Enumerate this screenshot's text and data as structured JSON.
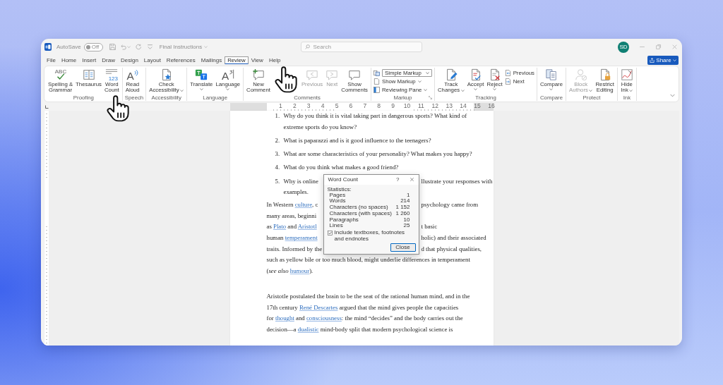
{
  "window": {
    "title": "Final Instructions",
    "autosave": {
      "label": "AutoSave",
      "on": false,
      "state": "Off"
    },
    "search": {
      "placeholder": "Search"
    },
    "account": {
      "initials": "SD"
    }
  },
  "menu": {
    "tabs": [
      {
        "label": "File",
        "selected": false
      },
      {
        "label": "Home",
        "selected": false
      },
      {
        "label": "Insert",
        "selected": false
      },
      {
        "label": "Draw",
        "selected": false
      },
      {
        "label": "Design",
        "selected": false
      },
      {
        "label": "Layout",
        "selected": false
      },
      {
        "label": "References",
        "selected": false
      },
      {
        "label": "Mailings",
        "selected": false
      },
      {
        "label": "Review",
        "selected": true
      },
      {
        "label": "View",
        "selected": false
      },
      {
        "label": "Help",
        "selected": false
      }
    ],
    "share": {
      "label": "Share"
    }
  },
  "ribbon": {
    "groups": [
      {
        "label": "Proofing",
        "launcher": false,
        "items": [
          {
            "kind": "large",
            "label": "Spelling &\nGrammar",
            "glyph": "ABC",
            "dropdown": false,
            "disabled": false
          },
          {
            "kind": "large",
            "label": "Thesaurus",
            "dropdown": false,
            "disabled": false
          },
          {
            "kind": "large",
            "label": "Word\nCount",
            "glyph": "123",
            "dropdown": false,
            "disabled": false
          }
        ]
      },
      {
        "label": "Speech",
        "launcher": false,
        "items": [
          {
            "kind": "large",
            "label": "Read\nAloud",
            "glyph": "A",
            "dropdown": false,
            "disabled": false
          }
        ]
      },
      {
        "label": "Accessibility",
        "launcher": false,
        "items": [
          {
            "kind": "large",
            "label": "Check\nAccessibility",
            "dropdown": true,
            "disabled": false
          }
        ]
      },
      {
        "label": "Language",
        "launcher": false,
        "items": [
          {
            "kind": "large",
            "label": "Translate",
            "dropdown": true,
            "disabled": false
          },
          {
            "kind": "large",
            "label": "Language",
            "glyph": "A",
            "dropdown": true,
            "disabled": false
          }
        ]
      },
      {
        "label": "Comments",
        "launcher": false,
        "items": [
          {
            "kind": "large",
            "label": "New\nComment",
            "dropdown": false,
            "disabled": false
          },
          {
            "kind": "large",
            "label": "Previous",
            "dropdown": false,
            "disabled": true
          },
          {
            "kind": "large",
            "label": "Next",
            "dropdown": false,
            "disabled": true
          },
          {
            "kind": "large",
            "label": "Show\nComments",
            "dropdown": false,
            "disabled": false
          }
        ]
      },
      {
        "label": "Markup",
        "launcher": true,
        "items": [
          {
            "kind": "select",
            "label": "Simple Markup",
            "dropdown": true,
            "disabled": false
          },
          {
            "kind": "small",
            "label": "Show Markup",
            "dropdown": true,
            "disabled": false
          },
          {
            "kind": "small",
            "label": "Reviewing Pane",
            "dropdown": true,
            "disabled": false
          }
        ]
      },
      {
        "label": "Tracking",
        "launcher": false,
        "items": [
          {
            "kind": "large",
            "label": "Track\nChanges",
            "dropdown": true,
            "disabled": false
          },
          {
            "kind": "large",
            "label": "Accept",
            "dropdown": true,
            "disabled": false
          },
          {
            "kind": "large",
            "label": "Reject",
            "dropdown": true,
            "disabled": false
          },
          {
            "kind": "small",
            "label": "Previous",
            "dropdown": false,
            "disabled": false
          },
          {
            "kind": "small",
            "label": "Next",
            "dropdown": false,
            "disabled": false
          }
        ]
      },
      {
        "label": "Compare",
        "launcher": false,
        "items": [
          {
            "kind": "large",
            "label": "Compare",
            "dropdown": true,
            "disabled": false
          }
        ]
      },
      {
        "label": "Protect",
        "launcher": false,
        "items": [
          {
            "kind": "large",
            "label": "Block\nAuthors",
            "dropdown": true,
            "disabled": true
          },
          {
            "kind": "large",
            "label": "Restrict\nEditing",
            "dropdown": false,
            "disabled": false
          }
        ]
      },
      {
        "label": "Ink",
        "launcher": false,
        "items": [
          {
            "kind": "large",
            "label": "Hide\nInk",
            "dropdown": true,
            "disabled": false
          }
        ]
      }
    ]
  },
  "document": {
    "ruler": [
      "1",
      "2",
      "3",
      "4",
      "5",
      "6",
      "7",
      "8",
      "9",
      "10",
      "11",
      "12",
      "13",
      "14",
      "15",
      "16"
    ],
    "list": [
      {
        "number": "1.",
        "lines": [
          {
            "parts": [
              [
                {
                  "text": "Why do you think it is vital taking part in dangerous sports? What kind of",
                  "kind": "text"
                }
              ]
            ]
          },
          {
            "parts": [
              [
                {
                  "text": "extreme sports do you know?",
                  "kind": "text"
                }
              ]
            ]
          }
        ]
      },
      {
        "number": "2.",
        "lines": [
          {
            "parts": [
              [
                {
                  "text": "What is paparazzi and is it good influence to the teenagers?",
                  "kind": "text"
                }
              ]
            ]
          }
        ]
      },
      {
        "number": "3.",
        "lines": [
          {
            "parts": [
              [
                {
                  "text": "What are some characteristics of your personality? What makes you happy?",
                  "kind": "text"
                }
              ]
            ]
          }
        ]
      },
      {
        "number": "4.",
        "lines": [
          {
            "parts": [
              [
                {
                  "text": "What do you think what makes a good friend?",
                  "kind": "text"
                }
              ]
            ]
          }
        ]
      },
      {
        "number": "5.",
        "lines": [
          {
            "parts": [
              [
                {
                  "text": "Why is online",
                  "kind": "text"
                }
              ],
              [
                {
                  "text": "llustrate your responses with",
                  "kind": "text"
                }
              ]
            ]
          },
          {
            "parts": [
              [
                {
                  "text": "examples.",
                  "kind": "text"
                }
              ]
            ]
          }
        ]
      }
    ],
    "paragraphs": [
      {
        "lines": [
          {
            "parts": [
              [
                {
                  "text": "In Western ",
                  "kind": "text"
                },
                {
                  "text": "culture",
                  "kind": "link"
                },
                {
                  "text": ", c",
                  "kind": "text"
                }
              ],
              [
                {
                  "text": "psychology came from",
                  "kind": "text"
                }
              ]
            ]
          },
          {
            "parts": [
              [
                {
                  "text": "many areas, beginni",
                  "kind": "text"
                }
              ]
            ]
          },
          {
            "parts": [
              [
                {
                  "text": "as ",
                  "kind": "text"
                },
                {
                  "text": "Plato",
                  "kind": "link"
                },
                {
                  "text": " and ",
                  "kind": "text"
                },
                {
                  "text": "Aristotl",
                  "kind": "link"
                }
              ],
              [
                {
                  "text": "t basic",
                  "kind": "text"
                }
              ]
            ]
          },
          {
            "parts": [
              [
                {
                  "text": "human ",
                  "kind": "text"
                },
                {
                  "text": "temperament",
                  "kind": "link"
                }
              ],
              [
                {
                  "text": "holic) and their associated",
                  "kind": "text"
                }
              ]
            ]
          },
          {
            "parts": [
              [
                {
                  "text": "traits. Informed by the",
                  "kind": "text"
                }
              ],
              [
                {
                  "text": "d that physical qualities,",
                  "kind": "text"
                }
              ]
            ]
          },
          {
            "parts": [
              [
                {
                  "text": "such as yellow bile or too much blood, might underlie differences in temperament",
                  "kind": "text"
                }
              ]
            ]
          },
          {
            "parts": [
              [
                {
                  "text": "(*see also* ",
                  "kind": "text"
                },
                {
                  "text": "humour",
                  "kind": "link"
                },
                {
                  "text": ").",
                  "kind": "text"
                }
              ]
            ]
          }
        ]
      },
      {
        "lines": [
          {
            "parts": [
              [
                {
                  "text": "Aristotle postulated the brain to be the seat of the rational human mind, and in the",
                  "kind": "text"
                }
              ]
            ]
          },
          {
            "parts": [
              [
                {
                  "text": "17th century ",
                  "kind": "text"
                },
                {
                  "text": "René Descartes",
                  "kind": "link"
                },
                {
                  "text": " argued that the mind gives people the capacities",
                  "kind": "text"
                }
              ]
            ]
          },
          {
            "parts": [
              [
                {
                  "text": "for ",
                  "kind": "text"
                },
                {
                  "text": "thought",
                  "kind": "link"
                },
                {
                  "text": " and ",
                  "kind": "text"
                },
                {
                  "text": "consciousness",
                  "kind": "link"
                },
                {
                  "text": ": the mind “decides” and the body carries out the",
                  "kind": "text"
                }
              ]
            ]
          },
          {
            "parts": [
              [
                {
                  "text": "decision—a ",
                  "kind": "text"
                },
                {
                  "text": "dualistic",
                  "kind": "link"
                },
                {
                  "text": " mind-body split that modern psychological science is",
                  "kind": "text"
                }
              ]
            ]
          }
        ]
      }
    ]
  },
  "word_count_dialog": {
    "title": "Word Count",
    "help": "?",
    "section": "Statistics:",
    "stats": [
      {
        "label": "Pages",
        "value": "1"
      },
      {
        "label": "Words",
        "value": "214"
      },
      {
        "label": "Characters (no spaces)",
        "value": "1 152"
      },
      {
        "label": "Characters (with spaces)",
        "value": "1 260"
      },
      {
        "label": "Paragraphs",
        "value": "10"
      },
      {
        "label": "Lines",
        "value": "25"
      }
    ],
    "include_checkbox": {
      "label": "Include textboxes, footnotes and endnotes",
      "checked": true
    },
    "close_button": "Close"
  }
}
